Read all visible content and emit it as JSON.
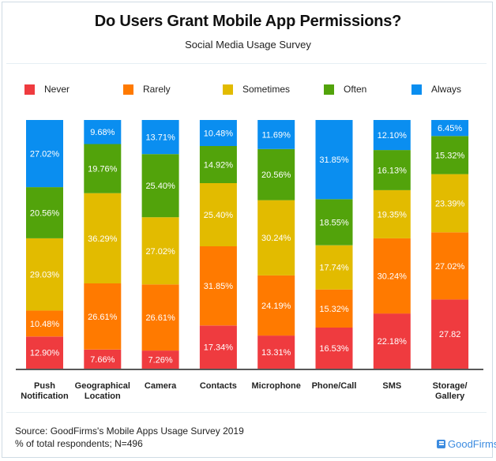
{
  "chart_data": {
    "type": "bar",
    "stacked": true,
    "title": "Do Users Grant Mobile App Permissions?",
    "subtitle": "Social Media Usage Survey",
    "xlabel": "",
    "ylabel": "% of total respondents",
    "ylim": [
      0,
      100
    ],
    "grid": false,
    "legend_position": "top",
    "categories": [
      "Push Notification",
      "Geographical Location",
      "Camera",
      "Contacts",
      "Microphone",
      "Phone/Call",
      "SMS",
      "Storage/ Gallery"
    ],
    "category_lines": [
      [
        "Push",
        "Notification"
      ],
      [
        "Geographical",
        "Location"
      ],
      [
        "Camera"
      ],
      [
        "Contacts"
      ],
      [
        "Microphone"
      ],
      [
        "Phone/Call"
      ],
      [
        "SMS"
      ],
      [
        "Storage/",
        "Gallery"
      ]
    ],
    "series": [
      {
        "name": "Never",
        "color": "#ef3b3f",
        "values": [
          12.9,
          7.66,
          7.26,
          17.34,
          13.31,
          16.53,
          22.18,
          27.82
        ],
        "labels": [
          "12.90%",
          "7.66%",
          "7.26%",
          "17.34%",
          "13.31%",
          "16.53%",
          "22.18%",
          "27.82"
        ]
      },
      {
        "name": "Rarely",
        "color": "#ff7a00",
        "values": [
          10.48,
          26.61,
          26.61,
          31.85,
          24.19,
          15.32,
          30.24,
          27.02
        ],
        "labels": [
          "10.48%",
          "26.61%",
          "26.61%",
          "31.85%",
          "24.19%",
          "15.32%",
          "30.24%",
          "27.02%"
        ]
      },
      {
        "name": "Sometimes",
        "color": "#e2bb00",
        "values": [
          29.03,
          36.29,
          27.02,
          25.4,
          30.24,
          17.74,
          19.35,
          23.39
        ],
        "labels": [
          "29.03%",
          "36.29%",
          "27.02%",
          "25.40%",
          "30.24%",
          "17.74%",
          "19.35%",
          "23.39%"
        ]
      },
      {
        "name": "Often",
        "color": "#52a30b",
        "values": [
          20.56,
          19.76,
          25.4,
          14.92,
          20.56,
          18.55,
          16.13,
          15.32
        ],
        "labels": [
          "20.56%",
          "19.76%",
          "25.40%",
          "14.92%",
          "20.56%",
          "18.55%",
          "16.13%",
          "15.32%"
        ]
      },
      {
        "name": "Always",
        "color": "#0a8ef0",
        "values": [
          27.02,
          9.68,
          13.71,
          10.48,
          11.69,
          31.85,
          12.1,
          6.45
        ],
        "labels": [
          "27.02%",
          "9.68%",
          "13.71%",
          "10.48%",
          "11.69%",
          "31.85%",
          "12.10%",
          "6.45%"
        ]
      }
    ]
  },
  "footer": {
    "source": "Source: GoodFirms's Mobile Apps Usage Survey 2019",
    "note": "% of total respondents; N=496",
    "brand": "GoodFirms",
    "brand_color": "#3b8be0"
  }
}
